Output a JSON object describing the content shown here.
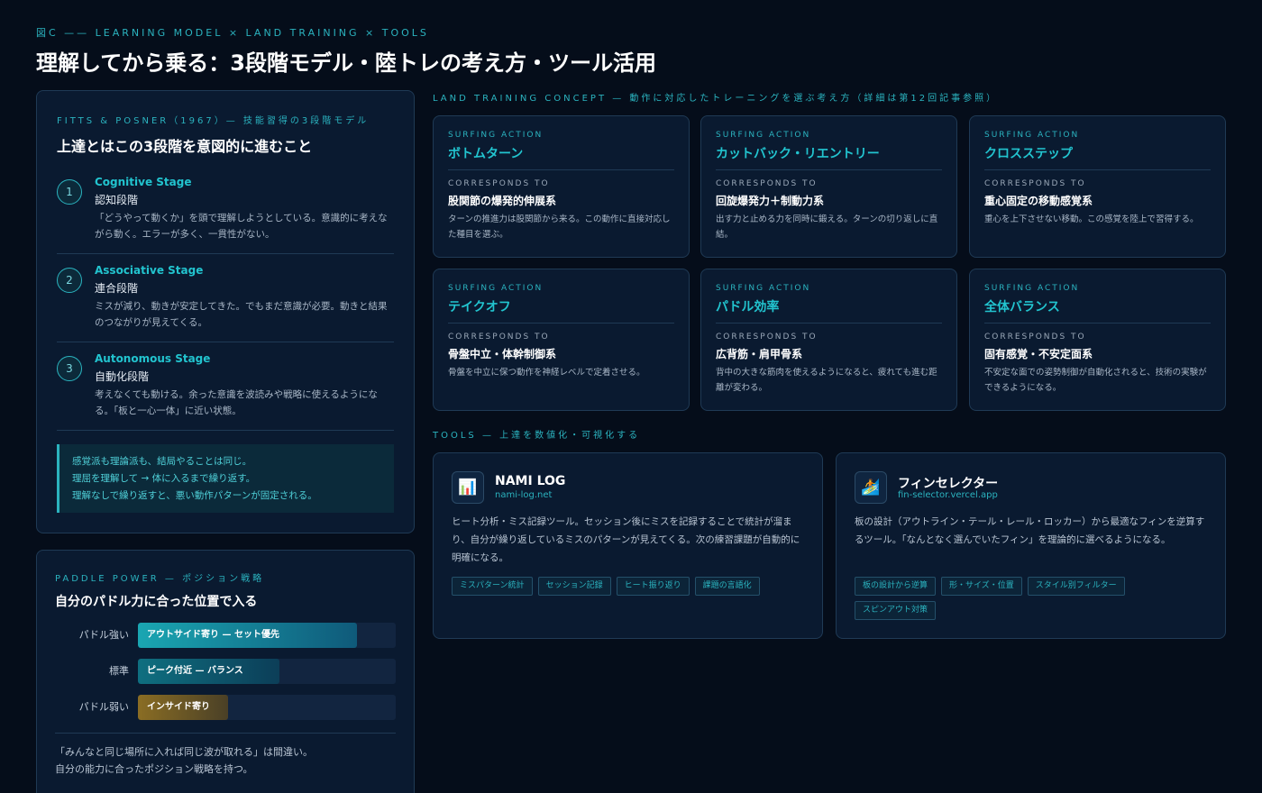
{
  "header": {
    "eyebrow": "図C —— LEARNING MODEL × LAND TRAINING × TOOLS",
    "title": "理解してから乗る：3段階モデル・陸トレの考え方・ツール活用"
  },
  "fitts": {
    "label": "FITTS & POSNER（1967）— 技能習得の3段階モデル",
    "title": "上達とはこの3段階を意図的に進むこと",
    "stages": [
      {
        "num": "1",
        "en": "Cognitive Stage",
        "jp": "認知段階",
        "desc": "「どうやって動くか」を頭で理解しようとしている。意識的に考えながら動く。エラーが多く、一貫性がない。"
      },
      {
        "num": "2",
        "en": "Associative Stage",
        "jp": "連合段階",
        "desc": "ミスが減り、動きが安定してきた。でもまだ意識が必要。動きと結果のつながりが見えてくる。"
      },
      {
        "num": "3",
        "en": "Autonomous Stage",
        "jp": "自動化段階",
        "desc": "考えなくても動ける。余った意識を波読みや戦略に使えるようになる。「板と一心一体」に近い状態。"
      }
    ],
    "quote": [
      "感覚派も理論派も、結局やることは同じ。",
      "理屈を理解して → 体に入るまで繰り返す。",
      "理解なしで繰り返すと、悪い動作パターンが固定される。"
    ]
  },
  "paddle": {
    "label": "PADDLE POWER — ポジション戦略",
    "title": "自分のパドル力に合った位置で入る",
    "rows": [
      {
        "label": "パドル強い",
        "text": "アウトサイド寄り — セット優先",
        "level": 0.85
      },
      {
        "label": "標準",
        "text": "ピーク付近 — バランス",
        "level": 0.55
      },
      {
        "label": "パドル弱い",
        "text": "インサイド寄り",
        "level": 0.35
      }
    ],
    "note": [
      "「みんなと同じ場所に入れば同じ波が取れる」は間違い。",
      "自分の能力に合ったポジション戦略を持つ。"
    ]
  },
  "land": {
    "label": "LAND TRAINING CONCEPT — 動作に対応したトレーニングを選ぶ考え方（詳細は第12回記事参照）",
    "sa_label": "SURFING ACTION",
    "cr_label": "CORRESPONDS TO",
    "cards": [
      {
        "action": "ボトムターン",
        "corr": "股関節の爆発的伸展系",
        "desc": "ターンの推進力は股関節から来る。この動作に直接対応した種目を選ぶ。"
      },
      {
        "action": "カットバック・リエントリー",
        "corr": "回旋爆発力＋制動力系",
        "desc": "出す力と止める力を同時に鍛える。ターンの切り返しに直結。"
      },
      {
        "action": "クロスステップ",
        "corr": "重心固定の移動感覚系",
        "desc": "重心を上下させない移動。この感覚を陸上で習得する。"
      },
      {
        "action": "テイクオフ",
        "corr": "骨盤中立・体幹制御系",
        "desc": "骨盤を中立に保つ動作を神経レベルで定着させる。"
      },
      {
        "action": "パドル効率",
        "corr": "広背筋・肩甲骨系",
        "desc": "背中の大きな筋肉を使えるようになると、疲れても進む距離が変わる。"
      },
      {
        "action": "全体バランス",
        "corr": "固有感覚・不安定面系",
        "desc": "不安定な面での姿勢制御が自動化されると、技術の実験ができるようになる。"
      }
    ]
  },
  "tools": {
    "label": "TOOLS — 上達を数値化・可視化する",
    "items": [
      {
        "icon": "📊",
        "name": "NAMI LOG",
        "url": "nami-log.net",
        "desc": "ヒート分析・ミス記録ツール。セッション後にミスを記録することで統計が溜まり、自分が繰り返しているミスのパターンが見えてくる。次の練習課題が自動的に明確になる。",
        "tags": [
          "ミスパターン統計",
          "セッション記録",
          "ヒート振り返り",
          "課題の言語化"
        ]
      },
      {
        "icon": "🏄",
        "name": "フィンセレクター",
        "url": "fin-selector.vercel.app",
        "desc": "板の設計（アウトライン・テール・レール・ロッカー）から最適なフィンを逆算するツール。「なんとなく選んでいたフィン」を理論的に選べるようになる。",
        "tags": [
          "板の設計から逆算",
          "形・サイズ・位置",
          "スタイル別フィルター",
          "スピンアウト対策"
        ]
      }
    ]
  }
}
